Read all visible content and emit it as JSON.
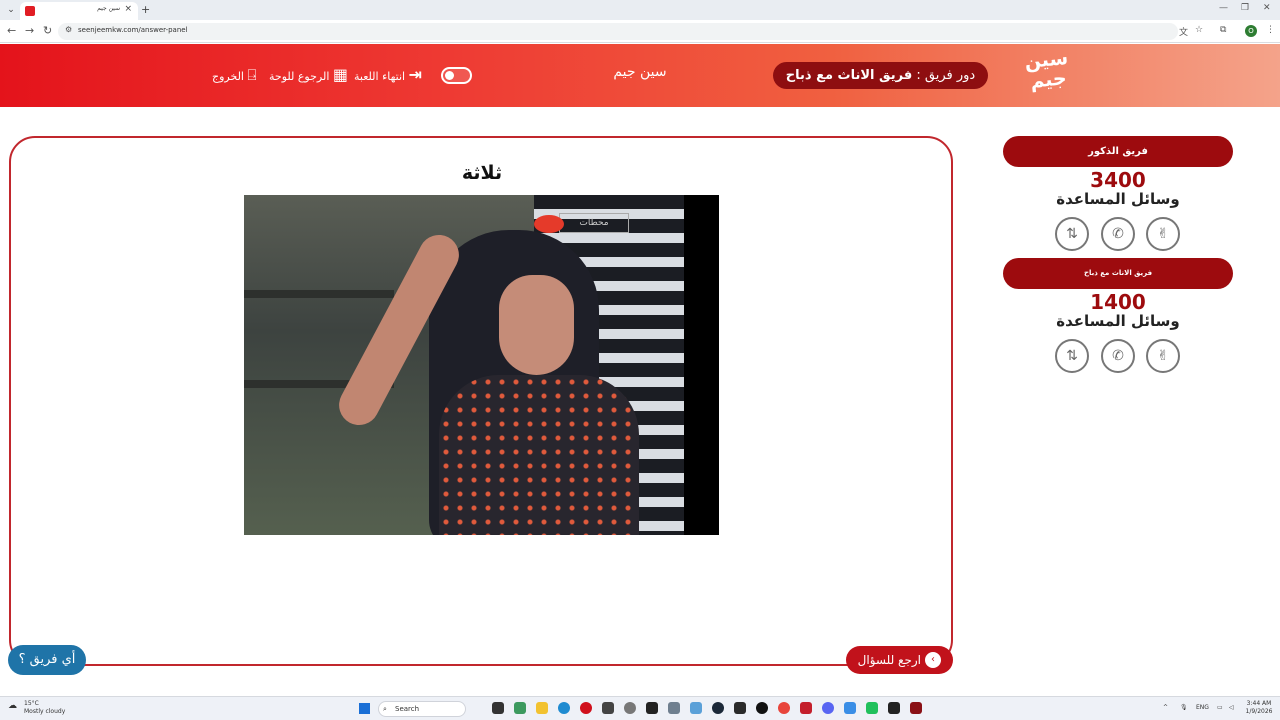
{
  "browser": {
    "tab_title": "سين جيم",
    "url": "seenjeemkw.com/answer-panel"
  },
  "header": {
    "logo_text": "سين جيم",
    "turn_prefix": "دور فريق : ",
    "turn_team": "فريق الاناث مع ذباح",
    "site_title": "سين جيم",
    "end_game_label": "انتهاء اللعبة",
    "back_to_board_label": "الرجوع للوحة",
    "exit_label": "الخروج"
  },
  "answer": {
    "title": "ثلاثة",
    "media_watermark": "محطات"
  },
  "buttons": {
    "back_to_question": "ارجع للسؤال",
    "which_team": "أي فريق ؟"
  },
  "teams": [
    {
      "name": "فريق الذكور",
      "score": "3400",
      "aids_label": "وسائل المساعدة"
    },
    {
      "name": "فريق الاناث مع ذباح",
      "score": "1400",
      "aids_label": "وسائل المساعدة"
    }
  ],
  "aid_icons": [
    "two-hands-icon",
    "phone-icon",
    "peace-hand-icon"
  ],
  "taskbar": {
    "temperature": "15°C",
    "weather": "Mostly cloudy",
    "search_label": "Search",
    "lang": "ENG",
    "time": "3:44 AM",
    "date": "1/9/2026"
  },
  "colors": {
    "brand_red": "#c1121b",
    "dark_red": "#9d0b0e",
    "blue_button": "#1f74a8"
  }
}
